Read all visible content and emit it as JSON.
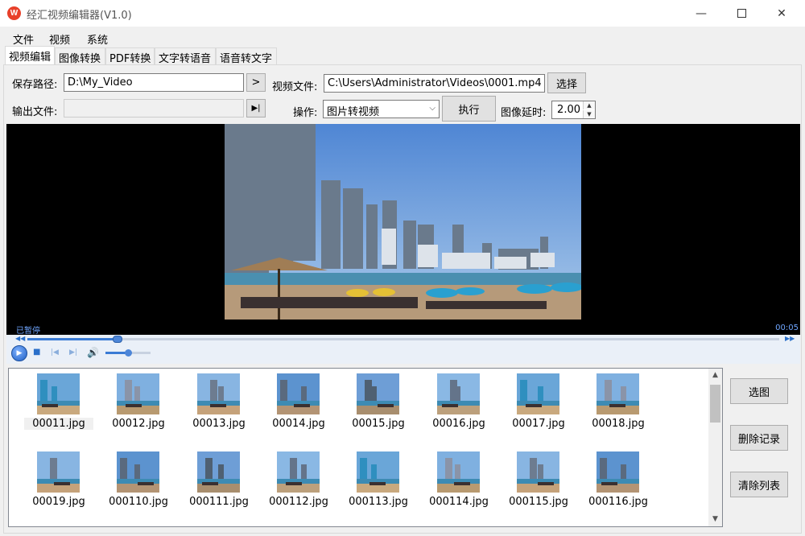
{
  "window": {
    "title": "经汇视频编辑器(V1.0)",
    "icon_letter": "W",
    "minimize_symbol": "—",
    "close_symbol": "✕"
  },
  "menu": [
    "文件",
    "视频",
    "系统"
  ],
  "tabs": [
    "视频编辑",
    "图像转换",
    "PDF转换",
    "文字转语音",
    "语音转文字"
  ],
  "active_tab": "视频编辑",
  "form": {
    "save_path_label": "保存路径:",
    "save_path_value": "D:\\My_Video",
    "browse_button": ">",
    "video_file_label": "视频文件:",
    "video_file_value": "C:\\Users\\Administrator\\Videos\\0001.mp4",
    "select_button": "选择",
    "output_file_label": "输出文件:",
    "output_file_value": "",
    "output_play_button": "▶|",
    "operation_label": "操作:",
    "operation_value": "图片转视频",
    "execute_button": "执行",
    "image_delay_label": "图像延时:",
    "image_delay_value": "2.00"
  },
  "player": {
    "status": "已暂停",
    "time": "00:05",
    "seek_progress": 0.12,
    "volume_level": 0.5
  },
  "thumbnails": [
    "00011.jpg",
    "00012.jpg",
    "00013.jpg",
    "00014.jpg",
    "00015.jpg",
    "00016.jpg",
    "00017.jpg",
    "00018.jpg",
    "00019.jpg",
    "000110.jpg",
    "000111.jpg",
    "000112.jpg",
    "000113.jpg",
    "000114.jpg",
    "000115.jpg",
    "000116.jpg"
  ],
  "selected_thumbnail": "00011.jpg",
  "side_buttons": {
    "select_image": "选图",
    "delete_record": "删除记录",
    "clear_list": "清除列表"
  },
  "colors": {
    "accent": "#3a7bd5",
    "app_icon": "#e8402a",
    "status_text": "#6fa6ff"
  }
}
